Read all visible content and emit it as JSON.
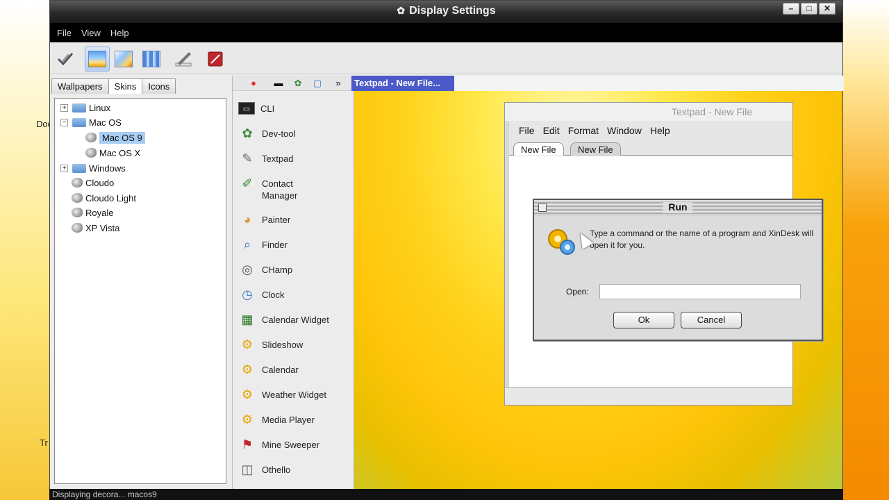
{
  "desktop": {
    "left_labels": [
      "Doc",
      "Tr"
    ]
  },
  "window": {
    "title": "Display Settings",
    "controls": {
      "minimize": "–",
      "maximize": "□",
      "close": "✕"
    },
    "menu": [
      "File",
      "View",
      "Help"
    ]
  },
  "toolbar": {
    "icons": [
      "checkmark-brush-icon",
      "wallpaper-icon",
      "wallpaper-alt-icon",
      "wallpaper-grid-icon",
      "pen-icon",
      "book-icon"
    ],
    "active_index": 1
  },
  "skins_panel": {
    "tabs": [
      "Wallpapers",
      "Skins",
      "Icons"
    ],
    "selected_tab": "Skins",
    "tree": [
      {
        "label": "Linux",
        "type": "folder",
        "expandable": true
      },
      {
        "label": "Mac OS",
        "type": "folder",
        "expanded": true
      },
      {
        "label": "Mac OS 9",
        "type": "skin",
        "selected": true
      },
      {
        "label": "Mac OS X",
        "type": "skin"
      },
      {
        "label": "Windows",
        "type": "folder",
        "expandable": true
      },
      {
        "label": "Cloudo",
        "type": "skin"
      },
      {
        "label": "Cloudo Light",
        "type": "skin"
      },
      {
        "label": "Royale",
        "type": "skin"
      },
      {
        "label": "XP Vista",
        "type": "skin"
      }
    ]
  },
  "launcher": {
    "apps": [
      "CLI",
      "Dev-tool",
      "Textpad",
      "Contact Manager",
      "Painter",
      "Finder",
      "CHamp",
      "Clock",
      "Calendar Widget",
      "Slideshow",
      "Calendar",
      "Weather Widget",
      "Media Player",
      "Mine Sweeper",
      "Othello"
    ],
    "taskbar_item": "Textpad - New File..."
  },
  "textpad": {
    "title": "Textpad - New File",
    "menu": [
      "File",
      "Edit",
      "Format",
      "Window",
      "Help"
    ],
    "tabs": [
      "New File",
      "New File"
    ]
  },
  "run_dialog": {
    "title": "Run",
    "message": "Type a command or the name of a program and XinDesk will open it for you.",
    "open_label": "Open:",
    "open_value": "",
    "ok_label": "Ok",
    "cancel_label": "Cancel"
  },
  "status": {
    "text": "Displaying decora... macos9"
  }
}
